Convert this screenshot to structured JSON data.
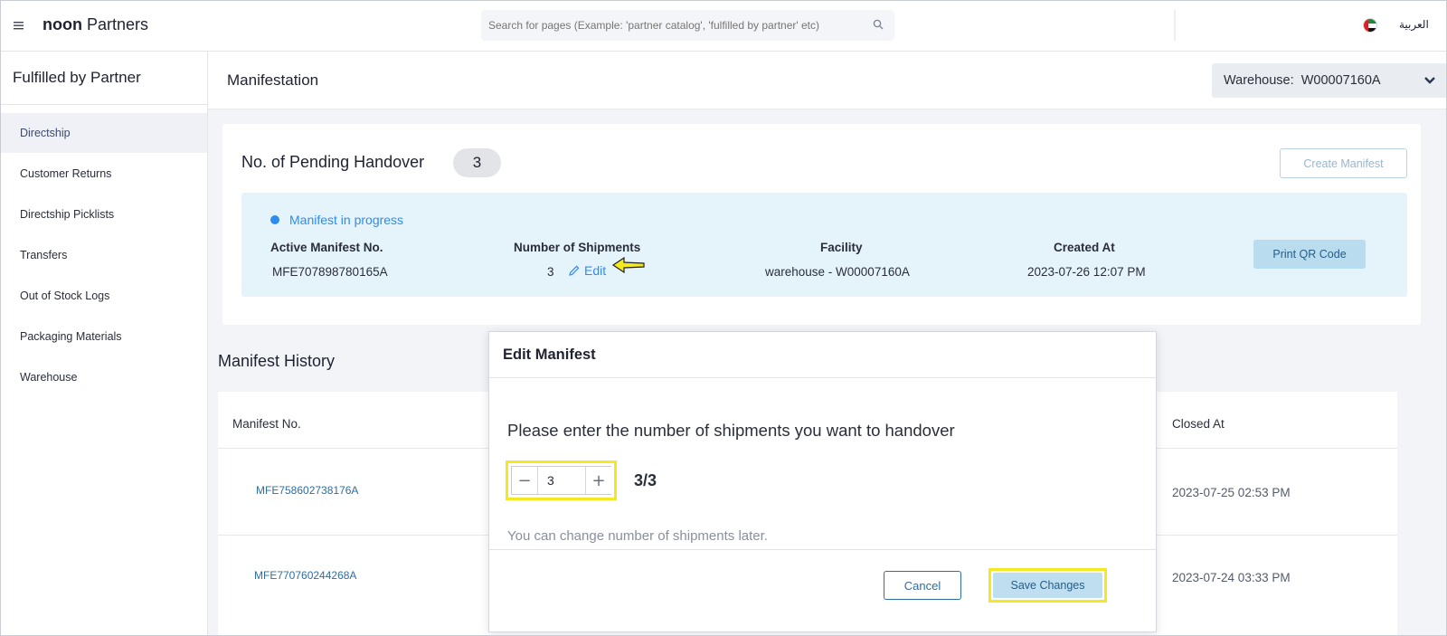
{
  "header": {
    "logo_bold": "noon",
    "logo_rest": "Partners",
    "search_placeholder": "Search for pages (Example: 'partner catalog', 'fulfilled by partner' etc)",
    "language": "العربية"
  },
  "sidebar": {
    "title": "Fulfilled by Partner",
    "items": [
      {
        "label": "Directship",
        "active": true
      },
      {
        "label": "Customer Returns"
      },
      {
        "label": "Directship Picklists"
      },
      {
        "label": "Transfers"
      },
      {
        "label": "Out of Stock Logs"
      },
      {
        "label": "Packaging Materials"
      },
      {
        "label": "Warehouse"
      }
    ]
  },
  "page": {
    "title": "Manifestation",
    "warehouse_label": "Warehouse:  W00007160A"
  },
  "pending": {
    "title": "No. of Pending Handover",
    "count": "3",
    "create_button": "Create Manifest",
    "status": "Manifest in progress",
    "columns": {
      "manifest_no": "Active Manifest No.",
      "shipments": "Number of Shipments",
      "facility": "Facility",
      "created_at": "Created At"
    },
    "values": {
      "manifest_no": "MFE707898780165A",
      "shipments": "3",
      "edit": "Edit",
      "facility": "warehouse - W00007160A",
      "created_at": "2023-07-26 12:07 PM"
    },
    "print_button": "Print QR Code"
  },
  "history": {
    "title": "Manifest History",
    "columns": {
      "manifest_no": "Manifest No.",
      "closed_at": "Closed At"
    },
    "rows": [
      {
        "manifest_no": "MFE758602738176A",
        "closed_at": "2023-07-25 02:53 PM"
      },
      {
        "manifest_no": "MFE770760244268A",
        "closed_at": "2023-07-24 03:33 PM"
      }
    ]
  },
  "modal": {
    "title": "Edit Manifest",
    "question": "Please enter the number of shipments you want to handover",
    "value": "3",
    "minus": "−",
    "plus": "+",
    "ratio": "3/3",
    "note": "You can change number of shipments later.",
    "cancel": "Cancel",
    "save": "Save Changes"
  },
  "colors": {
    "accent": "#2d8cf0",
    "highlight": "#f3e821",
    "progress_bg": "#e5f3fb",
    "active_sidebar": "#eff1f6"
  }
}
